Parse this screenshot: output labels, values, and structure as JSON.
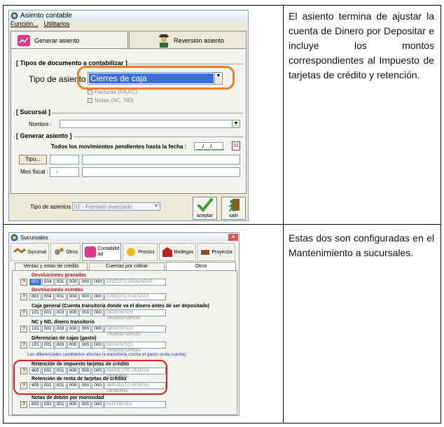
{
  "rows": [
    {
      "text": "El asiento termina de ajustar la cuenta de Dinero por Depositar e incluye los montos correspondientes al Impuesto de tarjetas de crédito y retención."
    },
    {
      "text": "Estas dos son configuradas en el Mantenimiento a sucursales."
    }
  ],
  "window1": {
    "title": "Asiento contable",
    "menu": [
      "Función...",
      "Utilitarios"
    ],
    "tabs": [
      "Generar asiento",
      "Reversión asiento"
    ],
    "tipos_group": "[ Tipos de documento a contabilizar ]",
    "tipo_label": "Tipo de asiento :",
    "tipo_value": "Cierres de caja",
    "check_facturas": "Facturas (FA,FC)",
    "check_notas": "Notas (NC, ND)",
    "sucursal_group": "[ Sucursal ]",
    "nombre_label": "Nombre :",
    "generar_group": "[ Generar asiento ]",
    "pendientes_label": "Todos los movimientos pendientes hasta la fecha :",
    "fecha_value": "__/__/____",
    "tipo_button": "Tipo...",
    "mes_label": "Mes fiscal :",
    "mes_value": "-",
    "tipo_asientos_label": "Tipo de asientos :",
    "tipo_asientos_value": "02 - Formato avanzado",
    "aceptar": "aceptar",
    "salir": "salir"
  },
  "window2": {
    "title": "Sucursales",
    "toolbar": [
      "Sucursal",
      "Otros",
      "Contabilid ad",
      "Precios",
      "Bodegas",
      "Proyector"
    ],
    "subtabs": [
      "Ventas y notas de crédito",
      "Cuentas por cobrar",
      "Otros"
    ],
    "q": "?",
    "accounts": [
      {
        "title": "Devoluciones gravadas",
        "segs": [
          "801",
          "004",
          "001",
          "003",
          "000",
          "000"
        ],
        "desc": "CREDITO GRAVADAS"
      },
      {
        "title": "Devoluciones exentas",
        "segs": [
          "801",
          "004",
          "001",
          "004",
          "000",
          "000"
        ],
        "desc": "CREDITO EXENTAS"
      },
      {
        "title": "Caja general (Cuenta transitoria donde va el dinero antes de ser depositado)",
        "segs": [
          "101",
          "001",
          "003",
          "000",
          "000",
          "000"
        ],
        "desc": "DEPOSITOS TRANSITORIOS"
      },
      {
        "title": "NC y ND, dinero transitorio",
        "segs": [
          "101",
          "001",
          "003",
          "000",
          "000",
          "000"
        ],
        "desc": "DEPOSITOS TRANSITORIOS"
      },
      {
        "title": "Diferencias de cajas (gasto)",
        "segs": [
          "101",
          "001",
          "003",
          "000",
          "000",
          "000"
        ],
        "desc": "DEPOSITOS TRANSITORIOS"
      },
      {
        "title": "Retención de impuesto tarjetas de crédito",
        "segs": [
          "405",
          "001",
          "001",
          "000",
          "000",
          "000"
        ],
        "desc": "IMPUESTO VENTAS GENERAL"
      },
      {
        "title": "Retención de renta de tarjetas de crédito",
        "segs": [
          "405",
          "001",
          "001",
          "000",
          "000",
          "000"
        ],
        "desc": "IMPUESTO VENTAS GENERAL"
      },
      {
        "title": "Notas de debito por morosidad",
        "segs": [
          "803",
          "001",
          "001",
          "000",
          "000",
          "000"
        ],
        "desc": "INTERESES"
      }
    ],
    "note": "Los diferenciales cambiarios afectan la transitoria contra el gasto (esta cuenta)"
  },
  "colors": {
    "highlight": "#f07f1e",
    "circle": "#e02020",
    "selected": "#3a6fd8",
    "red_title": "#c0141b"
  }
}
